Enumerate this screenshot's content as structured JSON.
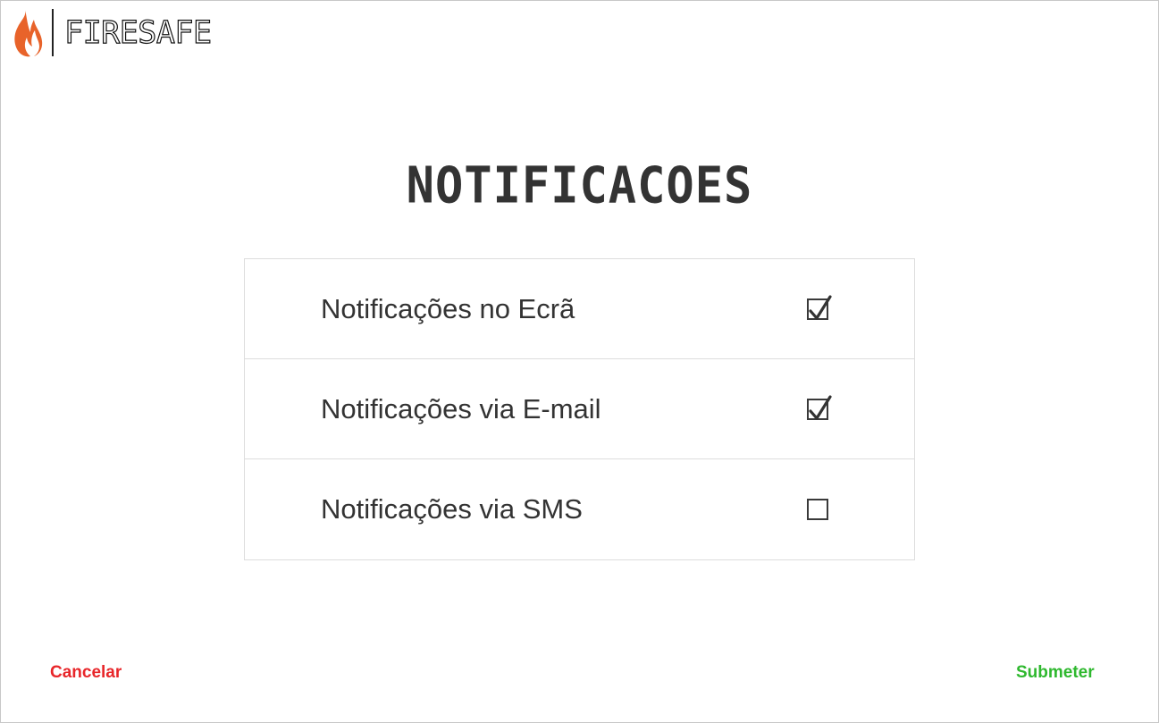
{
  "brand": {
    "name": "FIRESAFE",
    "flame_color": "#e8632a"
  },
  "page": {
    "title": "NOTIFICACOES"
  },
  "settings": [
    {
      "label": "Notificações no Ecrã",
      "checked": true
    },
    {
      "label": "Notificações via E-mail",
      "checked": true
    },
    {
      "label": "Notificações via SMS",
      "checked": false
    }
  ],
  "footer": {
    "cancel_label": "Cancelar",
    "submit_label": "Submeter",
    "cancel_color": "#e8262a",
    "submit_color": "#2eb82e"
  }
}
